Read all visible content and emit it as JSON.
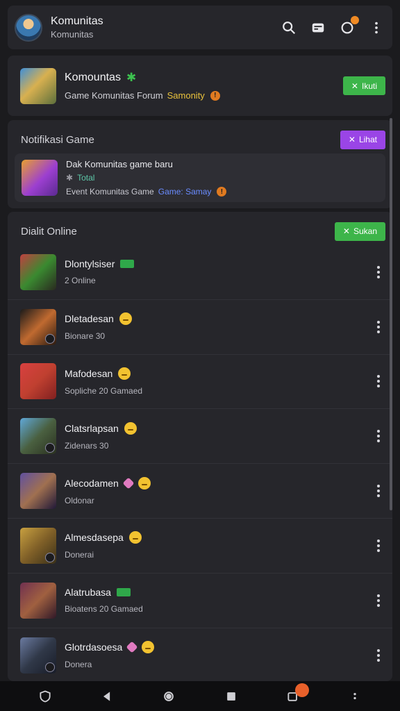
{
  "header": {
    "title": "Komunitas",
    "subtitle": "Komunitas",
    "icons": [
      "search-icon",
      "chat-icon",
      "notification-icon",
      "more-icon"
    ]
  },
  "community": {
    "title": "Komountas",
    "meta_text": "Game Komunitas Forum",
    "meta_accent": "Samonity",
    "button_label": "Ikuti",
    "accent_color": "#3db54a"
  },
  "notifications": {
    "section_title": "Notifikasi Game",
    "button_label": "Lihat",
    "item": {
      "line1": "Dak Komunitas game baru",
      "line2": "Total",
      "line3": "Event Komunitas Game",
      "line3_accent": "Game: Samay"
    }
  },
  "online": {
    "section_title": "Dialit Online",
    "button_label": "Sukan",
    "players": [
      {
        "name": "Dlontylsiser",
        "status": "2 Online",
        "badge": "green-tag",
        "thumb": [
          "#c04040",
          "#3a8a30",
          "#2a2a20"
        ]
      },
      {
        "name": "Dletadesan",
        "status": "Bionare 30",
        "badge": "smile-emoji",
        "thumb": [
          "#1a1a1a",
          "#c06a30",
          "#2a1a10"
        ]
      },
      {
        "name": "Mafodesan",
        "status": "Sopliche 20 Gamaed",
        "badge": "smile-emoji",
        "thumb": [
          "#d84040",
          "#c04030",
          "#802020"
        ]
      },
      {
        "name": "Clatsrlapsan",
        "status": "Zidenars 30",
        "badge": "smile-emoji",
        "thumb": [
          "#60a8d8",
          "#4a6040",
          "#2a3020"
        ]
      },
      {
        "name": "Alecodamen",
        "status": "Oldonar",
        "badge": "gem-smile",
        "thumb": [
          "#6050a0",
          "#a07050",
          "#201838"
        ]
      },
      {
        "name": "Almesdasepa",
        "status": "Donerai",
        "badge": "smile-emoji",
        "thumb": [
          "#c8a040",
          "#806028",
          "#3a3018"
        ]
      },
      {
        "name": "Alatrubasa",
        "status": "Bioatens 20 Gamaed",
        "badge": "green-tag",
        "thumb": [
          "#703050",
          "#a06040",
          "#301828"
        ]
      },
      {
        "name": "Glotrdasoesa",
        "status": "Donera",
        "badge": "gem-smile",
        "thumb": [
          "#6a7aa0",
          "#303848",
          "#181c28"
        ]
      }
    ]
  },
  "bottom_nav": [
    "shield-icon",
    "back-icon",
    "home-icon",
    "recents-icon",
    "notification-icon",
    "more-icon"
  ]
}
